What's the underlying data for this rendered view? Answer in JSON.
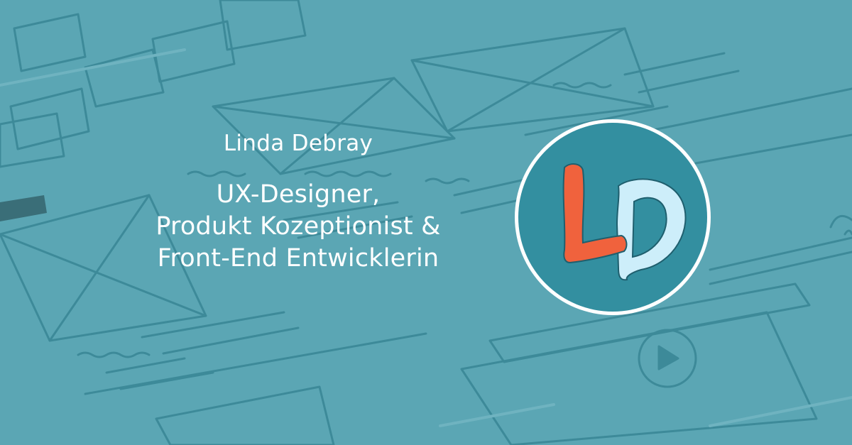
{
  "person": {
    "name": "Linda Debray",
    "roles": [
      "UX-Designer,",
      "Produkt Kozeptionist &",
      "Front-End Entwicklerin"
    ]
  },
  "logo": {
    "letters": "LD",
    "circle_color": "#338fa0",
    "l_color": "#f0623d",
    "d_color": "#cdeefa"
  },
  "background": {
    "base_color": "#5ba6b4",
    "motif": "hand-drawn-wireframe-sketch"
  }
}
